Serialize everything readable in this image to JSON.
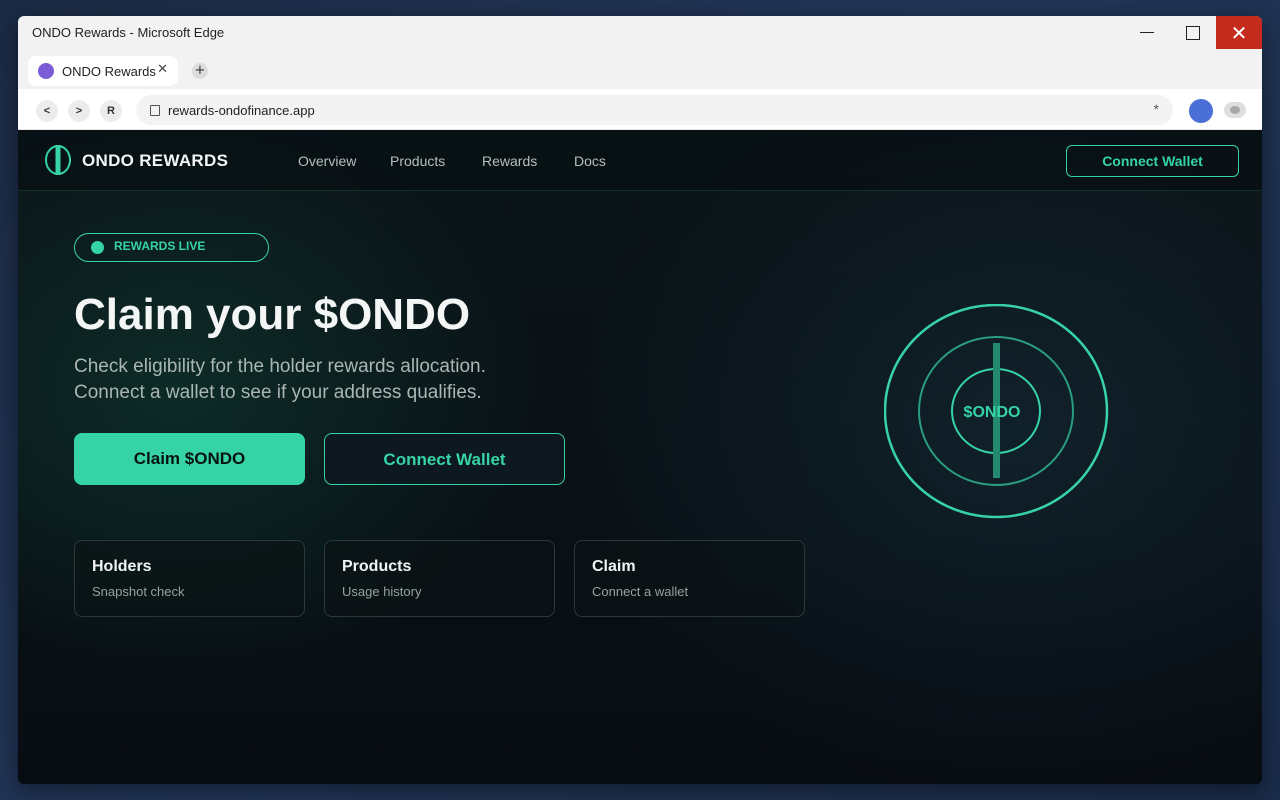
{
  "window": {
    "title": "ONDO Rewards - Microsoft Edge"
  },
  "browser": {
    "tab_title": "ONDO Rewards",
    "tab_close": "✕",
    "new_tab": "+",
    "back": "<",
    "forward": ">",
    "reload": "R",
    "url": "rewards-ondofinance.app",
    "favorite": "*"
  },
  "site": {
    "brand": "ONDO REWARDS",
    "nav": {
      "overview": "Overview",
      "products": "Products",
      "rewards": "Rewards",
      "docs": "Docs",
      "connect": "Connect Wallet"
    }
  },
  "hero": {
    "badge": "REWARDS LIVE",
    "title": "Claim your $ONDO",
    "subtitle_line1": "Check eligibility for the holder rewards allocation.",
    "subtitle_line2": "Connect a wallet to see if your address qualifies.",
    "claim_button": "Claim $ONDO",
    "connect_button": "Connect Wallet",
    "token_label": "$ONDO"
  },
  "cards": [
    {
      "title": "Holders",
      "subtitle": "Snapshot check"
    },
    {
      "title": "Products",
      "subtitle": "Usage history"
    },
    {
      "title": "Claim",
      "subtitle": "Connect a wallet"
    }
  ],
  "colors": {
    "accent": "#36d3a6",
    "background": "#0a1016",
    "close_button": "#c42b1c"
  },
  "icons": {
    "logo": "ondo-logo-icon",
    "url": "page-icon",
    "profile": "profile-avatar-icon",
    "extension": "extension-icon"
  }
}
